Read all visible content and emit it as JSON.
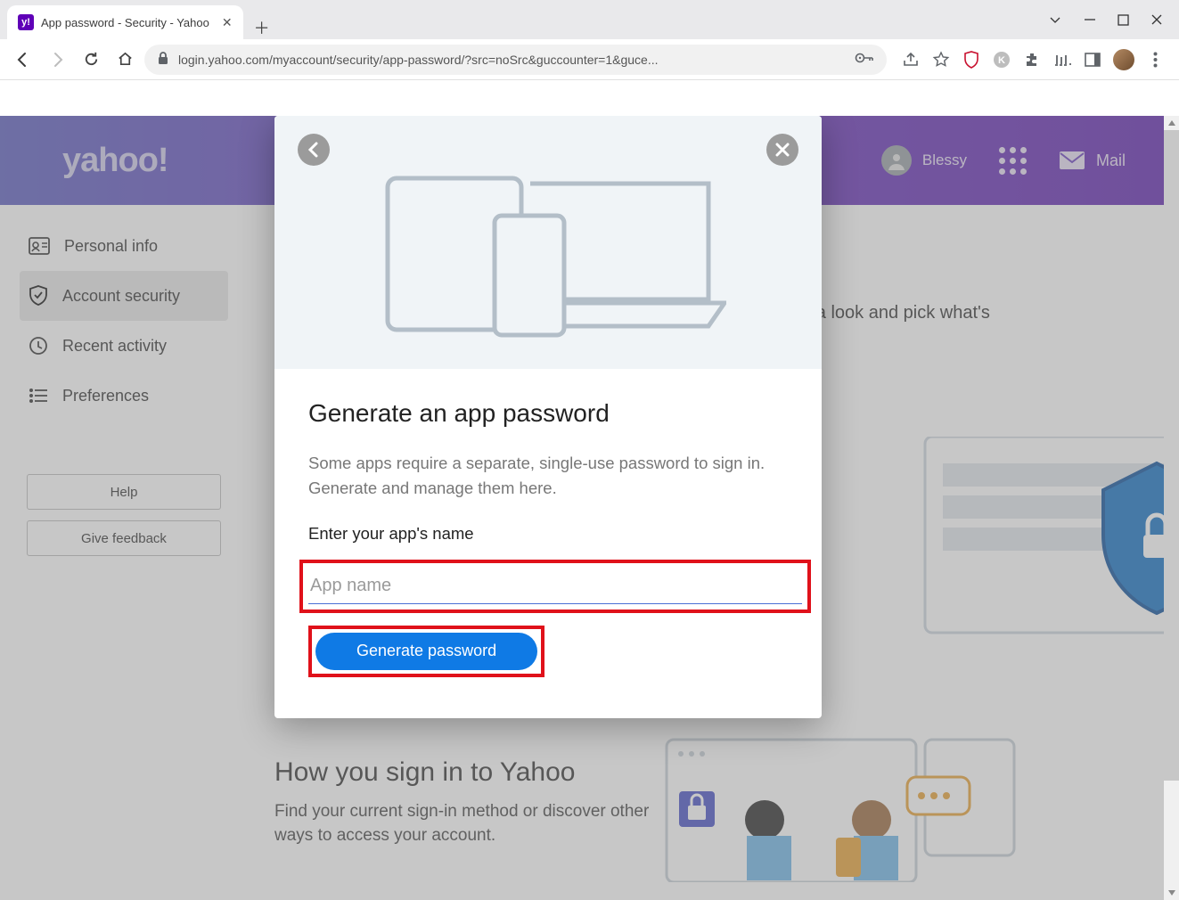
{
  "browser": {
    "tab_title": "App password - Security - Yahoo",
    "url": "login.yahoo.com/myaccount/security/app-password/?src=noSrc&guccounter=1&guce..."
  },
  "header": {
    "logo": "yahoo!",
    "user_name": "Blessy",
    "mail_label": "Mail"
  },
  "sidebar": {
    "items": [
      {
        "label": "Personal info"
      },
      {
        "label": "Account security"
      },
      {
        "label": "Recent activity"
      },
      {
        "label": "Preferences"
      }
    ],
    "help_label": "Help",
    "feedback_label": "Give feedback"
  },
  "background": {
    "peek_text": "ake a look and pick what's",
    "signin_title": "How you sign in to Yahoo",
    "signin_desc": "Find your current sign-in method or discover other ways to access your account."
  },
  "modal": {
    "title": "Generate an app password",
    "description": "Some apps require a separate, single-use password to sign in. Generate and manage them here.",
    "field_label": "Enter your app's name",
    "placeholder": "App name",
    "button_label": "Generate password"
  }
}
